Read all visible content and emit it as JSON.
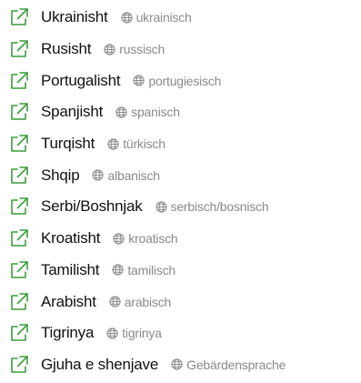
{
  "accent_color": "#3c9c3c",
  "icons": {
    "link": "external-link-icon",
    "language": "globe-icon"
  },
  "languages": [
    {
      "name": "Ukrainisht",
      "native": "ukrainisch"
    },
    {
      "name": "Rusisht",
      "native": "russisch"
    },
    {
      "name": "Portugalisht",
      "native": "portugiesisch"
    },
    {
      "name": "Spanjisht",
      "native": "spanisch"
    },
    {
      "name": "Turqisht",
      "native": "türkisch"
    },
    {
      "name": "Shqip",
      "native": "albanisch"
    },
    {
      "name": "Serbi/Boshnjak",
      "native": "serbisch/bosnisch"
    },
    {
      "name": "Kroatisht",
      "native": "kroatisch"
    },
    {
      "name": "Tamilisht",
      "native": "tamilisch"
    },
    {
      "name": "Arabisht",
      "native": "arabisch"
    },
    {
      "name": "Tigrinya",
      "native": "tigrinya"
    },
    {
      "name": "Gjuha e shenjave",
      "native": "Gebärdensprache"
    }
  ]
}
